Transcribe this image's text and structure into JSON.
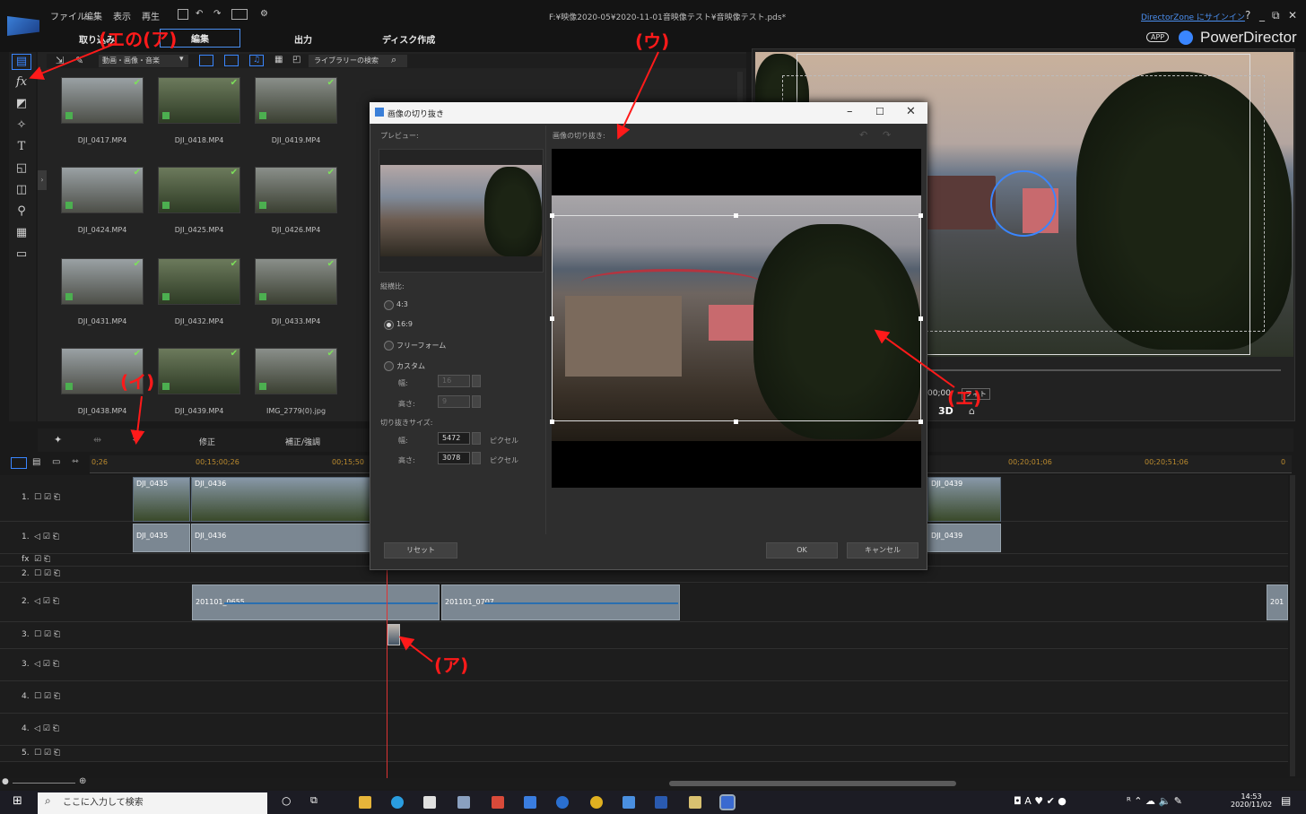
{
  "title_bar": {
    "menus": [
      "ファイル",
      "編集",
      "表示",
      "再生"
    ],
    "document_title": "F:¥映像2020-05¥2020-11-01音映像テスト¥音映像テスト.pds*",
    "directorzone_link": "DirectorZone にサインイン",
    "window_controls": [
      "?",
      "_",
      "⧉",
      "✕"
    ],
    "app_badge": "APP",
    "app_name": "PowerDirector"
  },
  "mode_tabs": [
    "取り込み",
    "編集",
    "出力",
    "ディスク作成"
  ],
  "library": {
    "filter_value": "動画・画像・音楽",
    "search_placeholder": "ライブラリーの検索",
    "items": [
      "DJI_0417.MP4",
      "DJI_0418.MP4",
      "DJI_0419.MP4",
      "DJI_0424.MP4",
      "DJI_0425.MP4",
      "DJI_0426.MP4",
      "DJI_0431.MP4",
      "DJI_0432.MP4",
      "DJI_0433.MP4",
      "DJI_0438.MP4",
      "DJI_0439.MP4",
      "IMG_2779(0).jpg"
    ]
  },
  "preview": {
    "timecode": "00;00",
    "fit_label": "フィト",
    "mode_3d": "3D"
  },
  "edit_bar": {
    "labels": [
      "修正",
      "補正/強調"
    ]
  },
  "timeline": {
    "ruler": [
      "0;26",
      "00;15;00;26",
      "00;15;50",
      "00;20;01;06",
      "00;20;51;06",
      "0"
    ],
    "tracks": [
      "1.",
      "1.",
      "fx",
      "2.",
      "2.",
      "3.",
      "3.",
      "4.",
      "4.",
      "5."
    ],
    "clips": {
      "video1": [
        "DJI_0435",
        "DJI_0436",
        "DJI_0439"
      ],
      "audio1": [
        "DJI_0435",
        "DJI_0436",
        "DJI_0439"
      ],
      "audio2": [
        "201101_0655",
        "201101_0707",
        "201"
      ]
    }
  },
  "dialog": {
    "title": "画像の切り抜き",
    "preview_label": "プレビュー:",
    "crop_label": "画像の切り抜き:",
    "aspect_label": "縦横比:",
    "aspect_options": [
      "4:3",
      "16:9",
      "フリーフォーム",
      "カスタム"
    ],
    "aspect_selected": "16:9",
    "custom_width_label": "幅:",
    "custom_width_value": "16",
    "custom_height_label": "高さ:",
    "custom_height_value": "9",
    "crop_size_label": "切り抜きサイズ:",
    "size_width_label": "幅:",
    "size_width_value": "5472",
    "size_height_label": "高さ:",
    "size_height_value": "3078",
    "unit": "ピクセル",
    "reset_button": "リセット",
    "ok_button": "OK",
    "cancel_button": "キャンセル"
  },
  "taskbar": {
    "search_placeholder": "ここに入力して検索",
    "time": "14:53",
    "date": "2020/11/02"
  },
  "annotations": {
    "a": "(ア)",
    "i": "(イ)",
    "u": "(ウ)",
    "e": "(エ)",
    "e_a": "(エの(ア)"
  },
  "colors": {
    "annotation": "#ff1a1a",
    "accent": "#3a86ff",
    "playhead": "#dd3333",
    "waveform": "#2a6fb0"
  }
}
